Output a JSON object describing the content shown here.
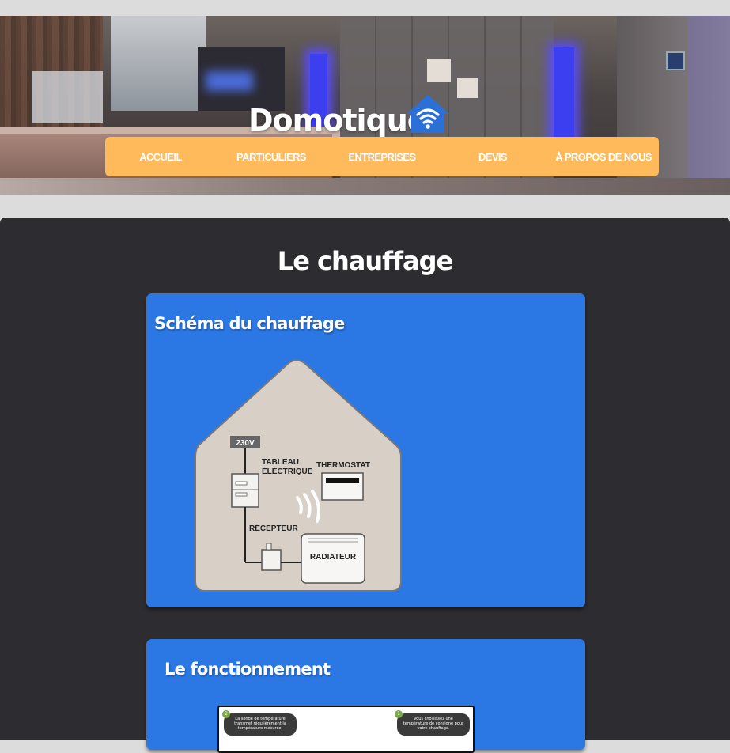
{
  "header": {
    "site_title": "Domotique",
    "logo_icon": "smart-home-icon",
    "logo_color": "#2b6fd8"
  },
  "nav": {
    "background": "#ffba5c",
    "items": [
      {
        "label": "ACCUEIL"
      },
      {
        "label": "PARTICULIERS"
      },
      {
        "label": "ENTREPRISES"
      },
      {
        "label": "DEVIS"
      },
      {
        "label": "À PROPOS DE NOUS"
      }
    ]
  },
  "main": {
    "title": "Le chauffage",
    "background": "#2d2c30",
    "card_color": "#2b78e4",
    "cards": [
      {
        "title": "Schéma du chauffage",
        "diagram": {
          "voltage": "230V",
          "panel": "TABLEAU\nÉLECTRIQUE",
          "thermostat": "THERMOSTAT",
          "receiver": "RÉCEPTEUR",
          "radiator": "RADIATEUR"
        }
      },
      {
        "title": "Le fonctionnement",
        "image": {
          "step1_number": "2",
          "step1_text": "La sonde de température transmet régulièrement la température mesurée.",
          "step2_number": "1",
          "step2_text": "Vous choisissez une température de consigne pour votre chauffage."
        }
      }
    ]
  }
}
